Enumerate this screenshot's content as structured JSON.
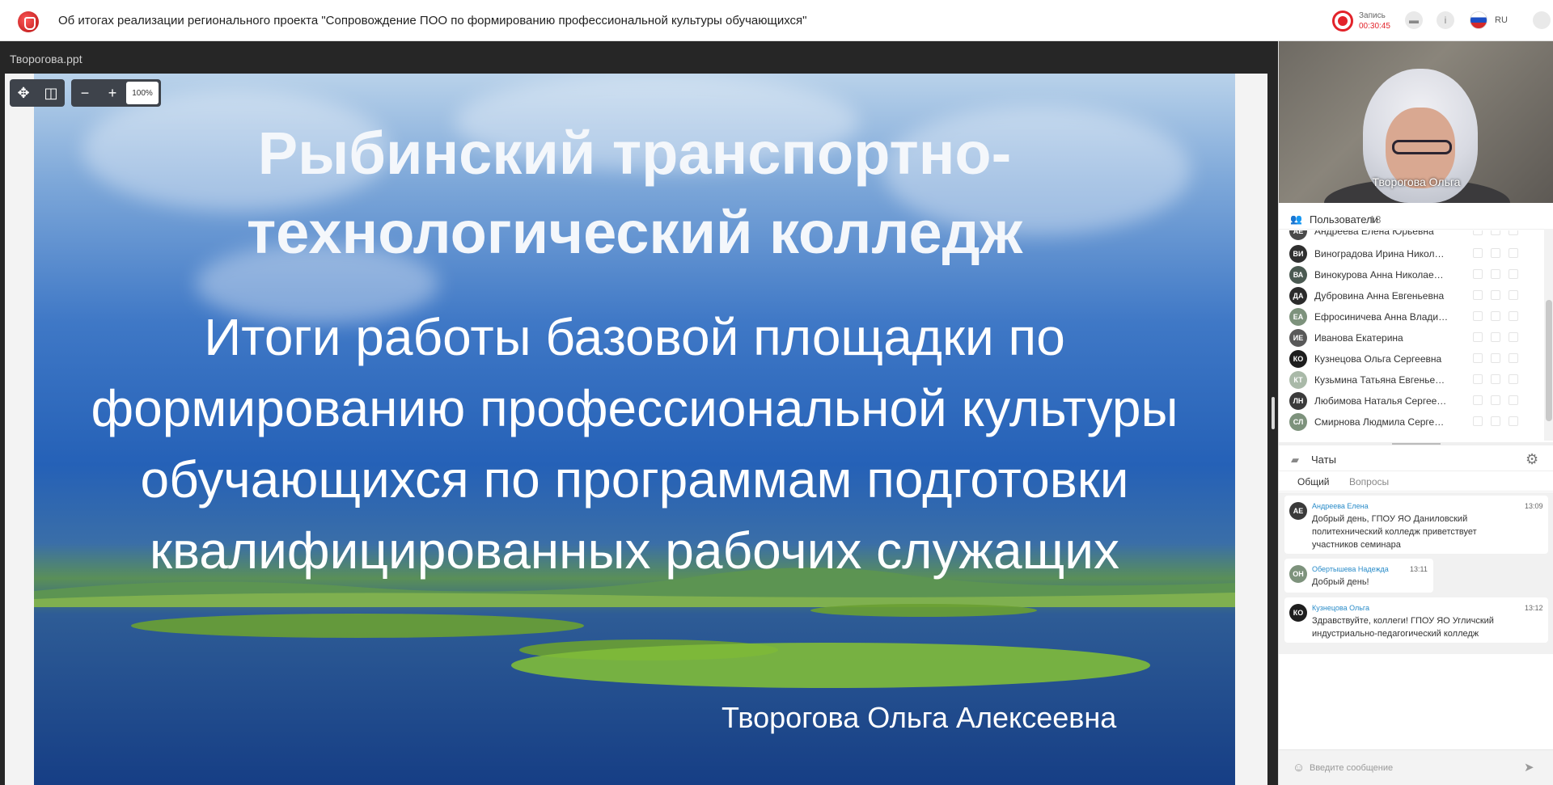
{
  "header": {
    "title": "Об итогах реализации регионального проекта \"Сопровождение ПОО по формированию профессиональной культуры обучающихся\"",
    "record_label": "Запись",
    "record_time": "00:30:45",
    "language": "RU"
  },
  "presentation": {
    "filename": "Творогова.ppt",
    "zoom": "100%",
    "slide": {
      "title_lines": [
        "Рыбинский транспортно-",
        "технологический колледж"
      ],
      "subtitle_lines": [
        "Итоги работы базовой площадки по",
        "формированию профессиональной культуры",
        "обучающихся по программам подготовки",
        "квалифицированных рабочих служащих"
      ],
      "author": "Творогова Ольга Алексеевна"
    }
  },
  "video": {
    "name": "Творогова Ольга"
  },
  "users": {
    "label": "Пользователи",
    "count": "13",
    "items": [
      {
        "initials": "АЕ",
        "name": "Андреева Елена Юрьевна",
        "color": "#4a4a4a"
      },
      {
        "initials": "ВИ",
        "name": "Виноградова Ирина Николаевна",
        "color": "#2f2f2f"
      },
      {
        "initials": "ВА",
        "name": "Винокурова Анна Николаевна",
        "color": "#4b5a52"
      },
      {
        "initials": "ДА",
        "name": "Дубровина Анна Евгеньевна",
        "color": "#2b2b2b"
      },
      {
        "initials": "ЕА",
        "name": "Ефросиничева Анна Владимировна",
        "color": "#7d927c"
      },
      {
        "initials": "ИЕ",
        "name": "Иванова Екатерина",
        "color": "#595959"
      },
      {
        "initials": "КО",
        "name": "Кузнецова Ольга Сергеевна",
        "color": "#1e1e1e"
      },
      {
        "initials": "КТ",
        "name": "Кузьмина Татьяна Евгеньевна",
        "color": "#a9b9a8"
      },
      {
        "initials": "ЛН",
        "name": "Любимова Наталья Сергеевна",
        "color": "#3b3b3b"
      },
      {
        "initials": "СЛ",
        "name": "Смирнова Людмила Сергеевна",
        "color": "#7d927c"
      }
    ]
  },
  "chats": {
    "label": "Чаты",
    "tabs": [
      "Общий",
      "Вопросы"
    ],
    "messages": [
      {
        "initials": "АЕ",
        "author": "Андреева Елена",
        "time": "13:09",
        "lines": [
          "Добрый день, ГПОУ ЯО Даниловский",
          "политехнический колледж приветствует",
          "участников семинара"
        ],
        "color": "#3b3b3b"
      },
      {
        "initials": "ОН",
        "author": "Обертышева Надежда",
        "time": "13:11",
        "lines": [
          "Добрый день!"
        ],
        "color": "#7d927c"
      },
      {
        "initials": "КО",
        "author": "Кузнецова Ольга",
        "time": "13:12",
        "lines": [
          "Здравствуйте, коллеги! ГПОУ ЯО Угличский",
          "индустриально-педагогический колледж"
        ],
        "color": "#1e1e1e"
      }
    ],
    "input_placeholder": "Введите сообщение"
  }
}
